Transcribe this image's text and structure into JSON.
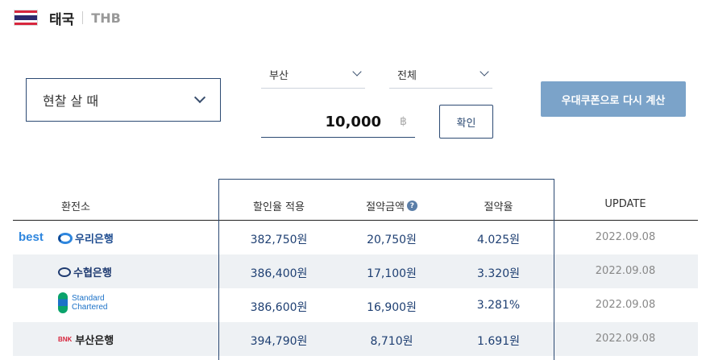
{
  "header": {
    "country": "태국",
    "currency": "THB"
  },
  "controls": {
    "type_select": "현찰 살 때",
    "city_select": "부산",
    "branch_select": "전체",
    "amount": "10,000",
    "currency_symbol": "฿",
    "confirm_label": "확인",
    "recalc_label": "우대쿠폰으로 다시 계산"
  },
  "table": {
    "headers": {
      "exchange": "환전소",
      "applied_rate": "할인율 적용",
      "saving_amount": "절약금액",
      "saving_ratio": "절약율",
      "update": "UPDATE"
    },
    "best_label": "best",
    "rows": [
      {
        "bank": "우리은행",
        "applied": "382,750원",
        "saving": "20,750원",
        "ratio": "4.025원",
        "update": "2022.09.08"
      },
      {
        "bank": "수협은행",
        "applied": "386,400원",
        "saving": "17,100원",
        "ratio": "3.320원",
        "update": "2022.09.08"
      },
      {
        "bank_line1": "Standard",
        "bank_line2": "Chartered",
        "applied": "386,600원",
        "saving": "16,900원",
        "ratio": "3.281%",
        "update": "2022.09.08"
      },
      {
        "bank_mark": "BNK",
        "bank": "부산은행",
        "applied": "394,790원",
        "saving": "8,710원",
        "ratio": "1.691원",
        "update": "2022.09.08"
      }
    ]
  },
  "icons": {
    "flag": "thailand-flag-icon",
    "help": "question-icon",
    "chevron": "chevron-down-icon"
  },
  "colors": {
    "accent": "#2c4a73",
    "button": "#7ba3c9",
    "best": "#2e86de"
  }
}
